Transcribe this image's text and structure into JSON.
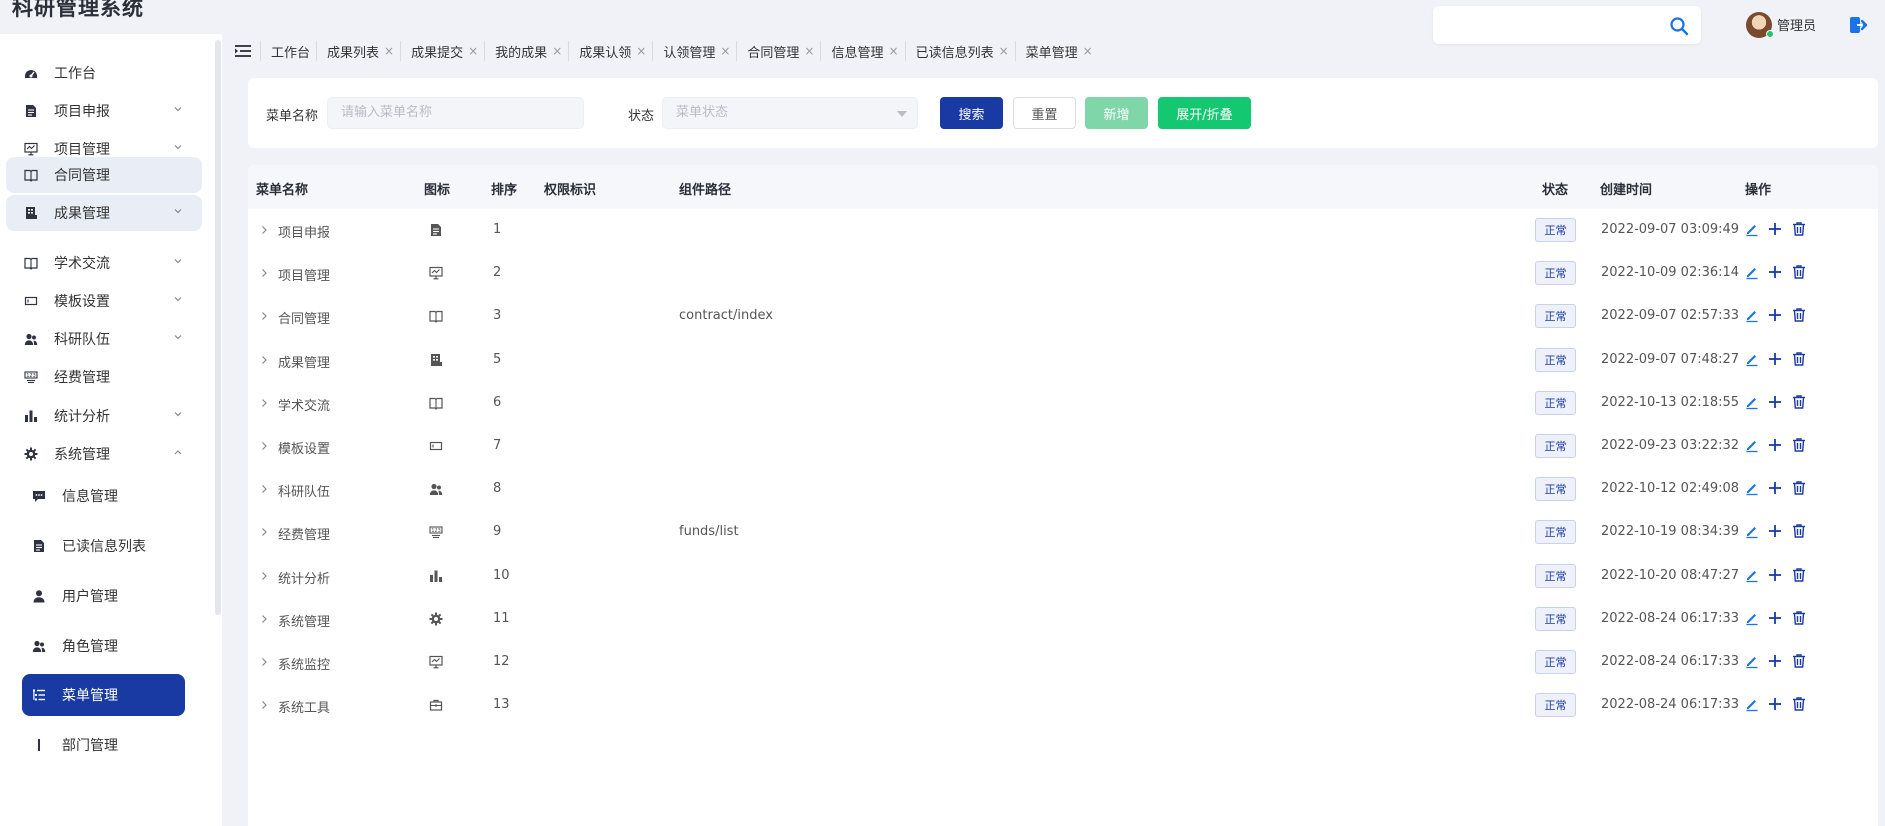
{
  "app": {
    "title": "科研管理系统"
  },
  "sidebar": {
    "items": [
      {
        "label": "工作台",
        "icon": "dashboard-icon",
        "chevron": false,
        "state": "normal"
      },
      {
        "label": "项目申报",
        "icon": "document-icon",
        "chevron": "down",
        "state": "normal"
      },
      {
        "label": "项目管理",
        "icon": "monitor-icon",
        "chevron": "down",
        "state": "normal"
      },
      {
        "label": "合同管理",
        "icon": "book-icon",
        "chevron": false,
        "state": "highlighted"
      },
      {
        "label": "成果管理",
        "icon": "building-icon",
        "chevron": "down",
        "state": "highlighted"
      },
      {
        "label": "学术交流",
        "icon": "book-icon",
        "chevron": "down",
        "state": "normal"
      },
      {
        "label": "模板设置",
        "icon": "template-icon",
        "chevron": "down",
        "state": "normal"
      },
      {
        "label": "科研队伍",
        "icon": "team-icon",
        "chevron": "down",
        "state": "normal"
      },
      {
        "label": "经费管理",
        "icon": "funds-icon",
        "chevron": false,
        "state": "normal"
      },
      {
        "label": "统计分析",
        "icon": "bar-chart-icon",
        "chevron": "down",
        "state": "normal"
      },
      {
        "label": "系统管理",
        "icon": "gear-icon",
        "chevron": "up",
        "state": "normal"
      }
    ],
    "sub_items": [
      {
        "label": "信息管理",
        "icon": "message-icon",
        "state": "normal"
      },
      {
        "label": "已读信息列表",
        "icon": "document-icon",
        "state": "normal"
      },
      {
        "label": "用户管理",
        "icon": "user-icon",
        "state": "normal"
      },
      {
        "label": "角色管理",
        "icon": "team-icon",
        "state": "normal"
      },
      {
        "label": "菜单管理",
        "icon": "menu-list-icon",
        "state": "active"
      },
      {
        "label": "部门管理",
        "icon": "dept-icon",
        "state": "normal"
      }
    ]
  },
  "header": {
    "search_placeholder": "",
    "user_name": "管理员"
  },
  "tabs": [
    {
      "label": "工作台",
      "closable": false
    },
    {
      "label": "成果列表",
      "closable": true
    },
    {
      "label": "成果提交",
      "closable": true
    },
    {
      "label": "我的成果",
      "closable": true
    },
    {
      "label": "成果认领",
      "closable": true
    },
    {
      "label": "认领管理",
      "closable": true
    },
    {
      "label": "合同管理",
      "closable": true
    },
    {
      "label": "信息管理",
      "closable": true
    },
    {
      "label": "已读信息列表",
      "closable": true
    },
    {
      "label": "菜单管理",
      "closable": true
    }
  ],
  "filter": {
    "menu_name_label": "菜单名称",
    "menu_name_placeholder": "请输入菜单名称",
    "status_label": "状态",
    "status_placeholder": "菜单状态",
    "search_button": "搜索",
    "reset_button": "重置",
    "add_button": "新增",
    "expand_button": "展开/折叠"
  },
  "table": {
    "columns": {
      "name": "菜单名称",
      "icon": "图标",
      "order": "排序",
      "perm": "权限标识",
      "path": "组件路径",
      "status": "状态",
      "created": "创建时间",
      "actions": "操作"
    },
    "rows": [
      {
        "name": "项目申报",
        "icon": "document-icon",
        "order": "1",
        "perm": "",
        "path": "",
        "status": "正常",
        "created": "2022-09-07 03:09:49"
      },
      {
        "name": "项目管理",
        "icon": "monitor-icon",
        "order": "2",
        "perm": "",
        "path": "",
        "status": "正常",
        "created": "2022-10-09 02:36:14"
      },
      {
        "name": "合同管理",
        "icon": "book-icon",
        "order": "3",
        "perm": "",
        "path": "contract/index",
        "status": "正常",
        "created": "2022-09-07 02:57:33"
      },
      {
        "name": "成果管理",
        "icon": "building-icon",
        "order": "5",
        "perm": "",
        "path": "",
        "status": "正常",
        "created": "2022-09-07 07:48:27"
      },
      {
        "name": "学术交流",
        "icon": "book-icon",
        "order": "6",
        "perm": "",
        "path": "",
        "status": "正常",
        "created": "2022-10-13 02:18:55"
      },
      {
        "name": "模板设置",
        "icon": "template-icon",
        "order": "7",
        "perm": "",
        "path": "",
        "status": "正常",
        "created": "2022-09-23 03:22:32"
      },
      {
        "name": "科研队伍",
        "icon": "team-icon",
        "order": "8",
        "perm": "",
        "path": "",
        "status": "正常",
        "created": "2022-10-12 02:49:08"
      },
      {
        "name": "经费管理",
        "icon": "funds-icon",
        "order": "9",
        "perm": "",
        "path": "funds/list",
        "status": "正常",
        "created": "2022-10-19 08:34:39"
      },
      {
        "name": "统计分析",
        "icon": "bar-chart-icon",
        "order": "10",
        "perm": "",
        "path": "",
        "status": "正常",
        "created": "2022-10-20 08:47:27"
      },
      {
        "name": "系统管理",
        "icon": "gear-icon",
        "order": "11",
        "perm": "",
        "path": "",
        "status": "正常",
        "created": "2022-08-24 06:17:33"
      },
      {
        "name": "系统监控",
        "icon": "monitor-icon",
        "order": "12",
        "perm": "",
        "path": "",
        "status": "正常",
        "created": "2022-08-24 06:17:33"
      },
      {
        "name": "系统工具",
        "icon": "toolbox-icon",
        "order": "13",
        "perm": "",
        "path": "",
        "status": "正常",
        "created": "2022-08-24 06:17:33"
      }
    ]
  },
  "colors": {
    "primary": "#1a3aa3",
    "success": "#13c871",
    "success_light": "#7fd6a9",
    "page_bg": "#f0f2f7"
  }
}
